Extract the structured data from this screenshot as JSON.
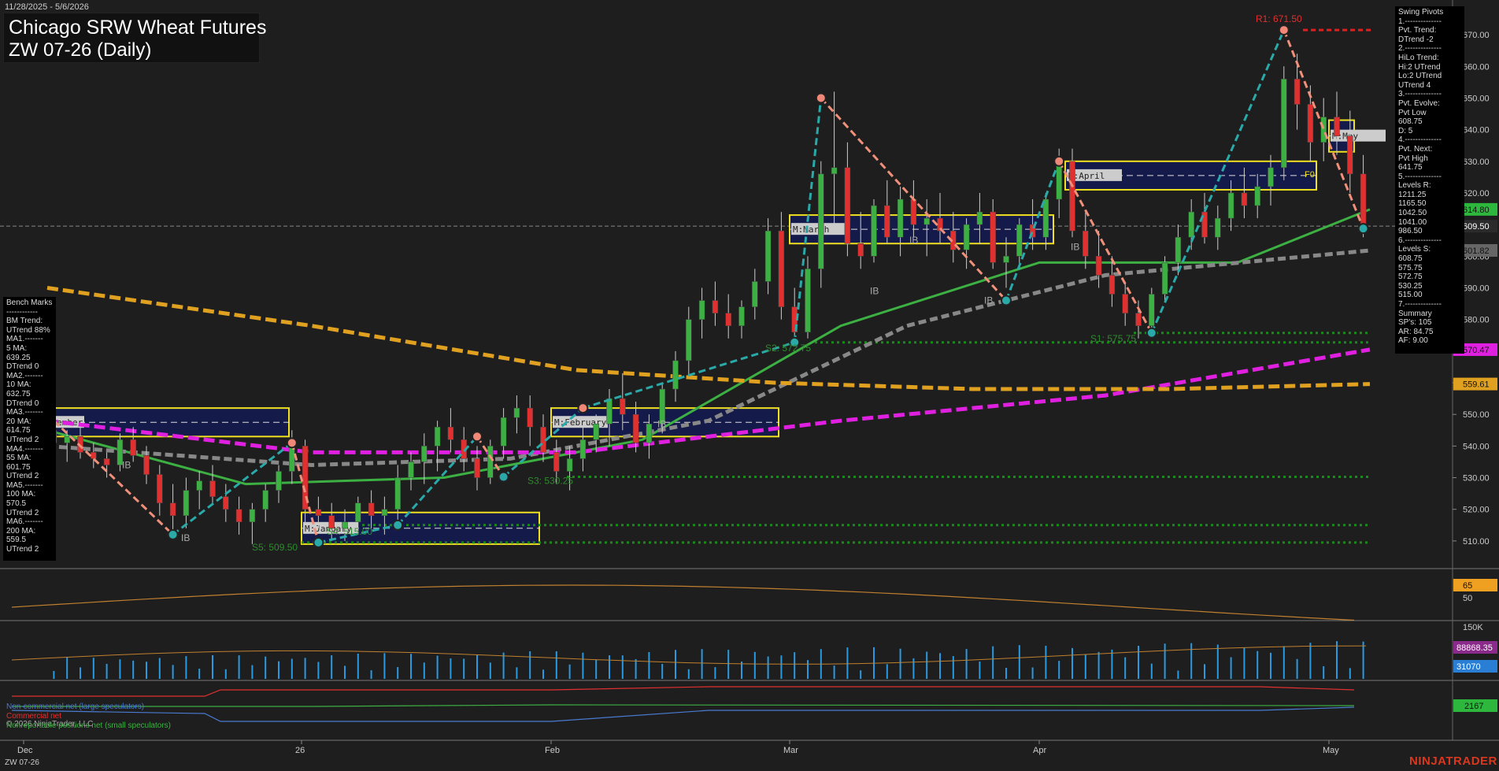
{
  "header": {
    "date_range": "11/28/2025 - 5/6/2026",
    "title": "Chicago SRW Wheat Futures",
    "subtitle": "ZW 07-26 (Daily)"
  },
  "footer": {
    "symbol": "ZW 07-26",
    "brand": "NINJATRADER",
    "copyright": "© 2026 NinjaTrader, LLC"
  },
  "swing_pivots_panel": {
    "lines": [
      "Swing Pivots",
      "1.--------------",
      "Pvt. Trend:",
      "DTrend -2",
      "2.--------------",
      "HiLo Trend:",
      "Hi:2 UTrend",
      "Lo:2 UTrend",
      "UTrend 4",
      "3.--------------",
      "Pvt. Evolve:",
      "Pvt Low",
      "608.75",
      "D: 5",
      "4.--------------",
      "Pvt. Next:",
      "Pvt High",
      "641.75",
      "5.--------------",
      "Levels R:",
      "1211.25",
      "1165.50",
      "1042.50",
      "1041.00",
      "986.50",
      "6.--------------",
      "Levels S:",
      "608.75",
      "575.75",
      "572.75",
      "530.25",
      "515.00",
      "7.--------------",
      "Summary",
      "SP's: 105",
      "AR: 84.75",
      "AF: 9.00"
    ]
  },
  "bench_marks_panel": {
    "lines": [
      "Bench Marks",
      "------------",
      "BM Trend:",
      "UTrend 88%",
      "MA1.-------",
      "5 MA:",
      "639.25",
      "DTrend 0",
      "MA2.-------",
      "10 MA:",
      "632.75",
      "DTrend 0",
      "MA3.-------",
      "20 MA:",
      "614.75",
      "UTrend 2",
      "MA4.-------",
      "55 MA:",
      "601.75",
      "UTrend 2",
      "MA5.-------",
      "100 MA:",
      "570.5",
      "UTrend 2",
      "MA6.-------",
      "200 MA:",
      "559.5",
      "UTrend 2"
    ]
  },
  "price_axis": {
    "ticks": [
      "670.00",
      "660.00",
      "650.00",
      "640.00",
      "630.00",
      "620.00",
      "610.00",
      "600.00",
      "590.00",
      "580.00",
      "570.00",
      "560.00",
      "550.00",
      "540.00",
      "530.00",
      "520.00",
      "510.00"
    ],
    "tags": [
      {
        "text": "614.80",
        "color": "#2db83d"
      },
      {
        "text": "609.50",
        "color": "#2b2b2b"
      },
      {
        "text": "601.82",
        "color": "#666666"
      },
      {
        "text": "570.47",
        "color": "#e020e0"
      },
      {
        "text": "559.61",
        "color": "#e0a020"
      }
    ]
  },
  "date_axis": [
    "Dec",
    "26",
    "Feb",
    "Mar",
    "Apr",
    "May"
  ],
  "pivot_labels": [
    {
      "text": "R1: 671.50",
      "color": "#e03030"
    },
    {
      "text": "S1: 575.75",
      "color": "#2e8b2e"
    },
    {
      "text": "S2: 572.75",
      "color": "#2e8b2e"
    },
    {
      "text": "S3: 530.25",
      "color": "#2e8b2e"
    },
    {
      "text": "S4: 515.00",
      "color": "#2e8b2e"
    },
    {
      "text": "S5: 509.50",
      "color": "#2e8b2e"
    }
  ],
  "month_boxes": [
    "M:December",
    "M:January",
    "M:February",
    "M:March",
    "M:April",
    "M:May"
  ],
  "ib_label": "IB",
  "f0_label": "F0",
  "indicator1": {
    "tag": "65",
    "tick": "50"
  },
  "indicator2": {
    "tick": "150K",
    "tags": [
      {
        "text": "88868.35",
        "color": "#8a2a8a"
      },
      {
        "text": "31070",
        "color": "#2a7fd4"
      }
    ]
  },
  "cot": {
    "tag": "2167",
    "legend": [
      {
        "text": "Non-commercial net (large speculators)",
        "color": "#4a7bd0"
      },
      {
        "text": "Commercial net",
        "color": "#e03030"
      },
      {
        "text": "Nonreportable positions net (small speculators)",
        "color": "#3cb043"
      }
    ]
  },
  "chart_data": {
    "type": "candlestick",
    "title": "Chicago SRW Wheat Futures",
    "subtitle": "ZW 07-26 (Daily)",
    "ylim": [
      503,
      676
    ],
    "x_ticks": [
      "Dec",
      "26",
      "Feb",
      "Mar",
      "Apr",
      "May"
    ],
    "candles": [
      [
        545,
        548,
        538,
        541
      ],
      [
        541,
        545,
        535,
        543
      ],
      [
        543,
        546,
        536,
        538
      ],
      [
        538,
        541,
        533,
        536
      ],
      [
        536,
        538,
        530,
        534
      ],
      [
        534,
        544,
        532,
        542
      ],
      [
        542,
        546,
        535,
        537
      ],
      [
        537,
        540,
        528,
        531
      ],
      [
        531,
        534,
        518,
        522
      ],
      [
        522,
        528,
        512,
        518
      ],
      [
        518,
        530,
        514,
        526
      ],
      [
        526,
        532,
        520,
        529
      ],
      [
        529,
        534,
        522,
        524
      ],
      [
        524,
        528,
        516,
        520
      ],
      [
        520,
        524,
        512,
        516
      ],
      [
        516,
        522,
        509,
        520
      ],
      [
        520,
        528,
        516,
        526
      ],
      [
        526,
        534,
        522,
        532
      ],
      [
        532,
        545,
        528,
        540
      ],
      [
        540,
        542,
        516,
        520
      ],
      [
        520,
        524,
        514,
        518
      ],
      [
        518,
        522,
        510,
        514
      ],
      [
        514,
        520,
        510,
        516
      ],
      [
        516,
        524,
        512,
        522
      ],
      [
        522,
        526,
        514,
        518
      ],
      [
        518,
        524,
        512,
        520
      ],
      [
        520,
        534,
        516,
        530
      ],
      [
        530,
        538,
        526,
        535
      ],
      [
        535,
        544,
        528,
        540
      ],
      [
        540,
        548,
        532,
        546
      ],
      [
        546,
        552,
        538,
        542
      ],
      [
        542,
        546,
        532,
        536
      ],
      [
        536,
        540,
        526,
        530
      ],
      [
        530,
        542,
        528,
        540
      ],
      [
        540,
        552,
        536,
        549
      ],
      [
        549,
        556,
        544,
        552
      ],
      [
        552,
        556,
        540,
        546
      ],
      [
        546,
        550,
        535,
        538
      ],
      [
        538,
        542,
        528,
        532
      ],
      [
        532,
        540,
        526,
        536
      ],
      [
        536,
        546,
        532,
        542
      ],
      [
        542,
        550,
        538,
        547
      ],
      [
        547,
        558,
        540,
        555
      ],
      [
        555,
        563,
        545,
        550
      ],
      [
        550,
        554,
        538,
        541
      ],
      [
        541,
        550,
        536,
        547
      ],
      [
        547,
        560,
        544,
        558
      ],
      [
        558,
        570,
        554,
        567
      ],
      [
        567,
        584,
        562,
        580
      ],
      [
        580,
        590,
        574,
        586
      ],
      [
        586,
        592,
        578,
        582
      ],
      [
        582,
        588,
        574,
        578
      ],
      [
        578,
        586,
        574,
        584
      ],
      [
        584,
        596,
        580,
        592
      ],
      [
        592,
        612,
        588,
        608
      ],
      [
        608,
        614,
        580,
        584
      ],
      [
        584,
        590,
        572,
        576
      ],
      [
        576,
        600,
        574,
        596
      ],
      [
        596,
        630,
        590,
        626
      ],
      [
        626,
        652,
        610,
        628
      ],
      [
        628,
        636,
        600,
        604
      ],
      [
        604,
        614,
        596,
        600
      ],
      [
        600,
        618,
        598,
        616
      ],
      [
        616,
        624,
        604,
        606
      ],
      [
        606,
        622,
        600,
        618
      ],
      [
        618,
        624,
        606,
        610
      ],
      [
        610,
        618,
        600,
        612
      ],
      [
        612,
        620,
        604,
        608
      ],
      [
        608,
        614,
        598,
        602
      ],
      [
        602,
        612,
        596,
        610
      ],
      [
        610,
        620,
        604,
        614
      ],
      [
        614,
        618,
        596,
        598
      ],
      [
        598,
        606,
        590,
        600
      ],
      [
        600,
        612,
        596,
        610
      ],
      [
        610,
        618,
        602,
        606
      ],
      [
        606,
        620,
        602,
        618
      ],
      [
        618,
        634,
        612,
        630
      ],
      [
        630,
        634,
        606,
        608
      ],
      [
        608,
        614,
        596,
        600
      ],
      [
        600,
        608,
        590,
        594
      ],
      [
        594,
        600,
        584,
        588
      ],
      [
        588,
        592,
        578,
        582
      ],
      [
        582,
        586,
        574,
        578
      ],
      [
        578,
        590,
        576,
        588
      ],
      [
        588,
        600,
        586,
        598
      ],
      [
        598,
        610,
        594,
        606
      ],
      [
        606,
        618,
        602,
        614
      ],
      [
        614,
        620,
        604,
        606
      ],
      [
        606,
        616,
        602,
        612
      ],
      [
        612,
        624,
        608,
        620
      ],
      [
        620,
        628,
        612,
        616
      ],
      [
        616,
        626,
        612,
        622
      ],
      [
        622,
        632,
        616,
        628
      ],
      [
        628,
        660,
        624,
        656
      ],
      [
        656,
        664,
        640,
        648
      ],
      [
        648,
        654,
        630,
        636
      ],
      [
        636,
        650,
        630,
        644
      ],
      [
        644,
        652,
        632,
        638
      ],
      [
        638,
        646,
        620,
        626
      ],
      [
        626,
        632,
        606,
        609
      ]
    ],
    "moving_averages": [
      {
        "name": "20 MA",
        "color": "#3cb043",
        "points": [
          [
            0,
            545
          ],
          [
            15,
            528
          ],
          [
            30,
            530
          ],
          [
            45,
            542
          ],
          [
            60,
            578
          ],
          [
            75,
            598
          ],
          [
            90,
            598
          ],
          [
            100,
            614.8
          ]
        ]
      },
      {
        "name": "55 MA",
        "color": "#888888",
        "points": [
          [
            0,
            540
          ],
          [
            20,
            534
          ],
          [
            35,
            536
          ],
          [
            50,
            548
          ],
          [
            65,
            578
          ],
          [
            80,
            594
          ],
          [
            100,
            601.82
          ]
        ]
      },
      {
        "name": "100 MA",
        "color": "#e020e0",
        "points": [
          [
            0,
            548
          ],
          [
            20,
            538
          ],
          [
            40,
            538
          ],
          [
            60,
            548
          ],
          [
            80,
            556
          ],
          [
            100,
            570.47
          ]
        ]
      },
      {
        "name": "200 MA",
        "color": "#e0a020",
        "points": [
          [
            0,
            590
          ],
          [
            20,
            578
          ],
          [
            40,
            564
          ],
          [
            55,
            560
          ],
          [
            70,
            558
          ],
          [
            85,
            558
          ],
          [
            100,
            559.61
          ]
        ]
      }
    ],
    "pivots": {
      "highs": [
        [
          18,
          541
        ],
        [
          32,
          543
        ],
        [
          40,
          552
        ],
        [
          58,
          650
        ],
        [
          76,
          630
        ],
        [
          93,
          671.5
        ]
      ],
      "lows": [
        [
          9,
          512
        ],
        [
          20,
          509.5
        ],
        [
          26,
          515
        ],
        [
          34,
          530.25
        ],
        [
          56,
          572.75
        ],
        [
          72,
          586
        ],
        [
          83,
          575.75
        ],
        [
          99,
          608.75
        ]
      ]
    },
    "support_levels": [
      575.75,
      572.75,
      530.25,
      515.0,
      509.5
    ],
    "resistance_levels": [
      671.5
    ],
    "current_price": 609.5,
    "oscillator": {
      "last": 65
    },
    "volume": {
      "last": 31070,
      "avg": 88868.35
    },
    "cot_last": 2167
  }
}
